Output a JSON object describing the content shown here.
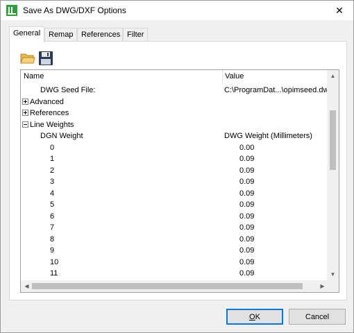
{
  "window": {
    "title": "Save As DWG/DXF Options",
    "icon": "app-icon",
    "close_glyph": "✕"
  },
  "tabs": [
    {
      "label": "General",
      "active": true
    },
    {
      "label": "Remap",
      "active": false
    },
    {
      "label": "References",
      "active": false
    },
    {
      "label": "Filter",
      "active": false
    }
  ],
  "toolbar": {
    "open_icon": "folder-open-icon",
    "save_icon": "floppy-disk-save-icon"
  },
  "grid": {
    "columns": [
      "Name",
      "Value"
    ],
    "rows": [
      {
        "name": "DWG Seed File:",
        "value": "C:\\ProgramDat...\\opimseed.dwg",
        "indent": 1,
        "expander": null
      },
      {
        "name": "Advanced",
        "value": "",
        "indent": 0,
        "expander": "plus"
      },
      {
        "name": "References",
        "value": "",
        "indent": 0,
        "expander": "plus"
      },
      {
        "name": "Line Weights",
        "value": "",
        "indent": 0,
        "expander": "minus"
      },
      {
        "name": "DGN Weight",
        "value": "DWG Weight (Millimeters)",
        "indent": 1,
        "expander": null
      },
      {
        "name": "0",
        "value": "0.00",
        "indent": 2,
        "expander": null
      },
      {
        "name": "1",
        "value": "0.09",
        "indent": 2,
        "expander": null
      },
      {
        "name": "2",
        "value": "0.09",
        "indent": 2,
        "expander": null
      },
      {
        "name": "3",
        "value": "0.09",
        "indent": 2,
        "expander": null
      },
      {
        "name": "4",
        "value": "0.09",
        "indent": 2,
        "expander": null
      },
      {
        "name": "5",
        "value": "0.09",
        "indent": 2,
        "expander": null
      },
      {
        "name": "6",
        "value": "0.09",
        "indent": 2,
        "expander": null
      },
      {
        "name": "7",
        "value": "0.09",
        "indent": 2,
        "expander": null
      },
      {
        "name": "8",
        "value": "0.09",
        "indent": 2,
        "expander": null
      },
      {
        "name": "9",
        "value": "0.09",
        "indent": 2,
        "expander": null
      },
      {
        "name": "10",
        "value": "0.09",
        "indent": 2,
        "expander": null
      },
      {
        "name": "11",
        "value": "0.09",
        "indent": 2,
        "expander": null
      }
    ]
  },
  "buttons": {
    "ok_first": "O",
    "ok_rest": "K",
    "cancel": "Cancel"
  },
  "colors": {
    "accent": "#0078d7",
    "app_icon": "#2e9e3f"
  }
}
